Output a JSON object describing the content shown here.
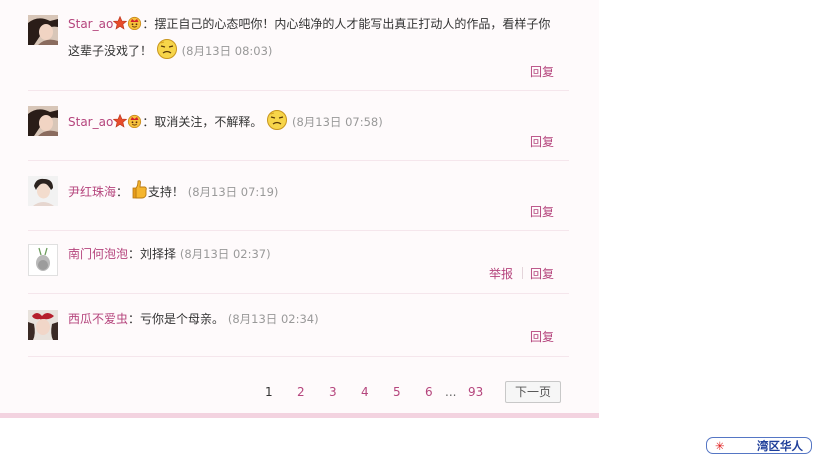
{
  "comments": [
    {
      "username": "Star_ao",
      "text_line1": "：摆正自己的心态吧你！内心纯净的人才能写出真正打动人的作品，看样子你",
      "text_line2": "这辈子没戏了！",
      "time": "(8月13日 08:03)",
      "reply_label": "回复",
      "badges": [
        "star-badge-icon",
        "crown-badge-icon"
      ],
      "emoticon": "sneer-face-icon"
    },
    {
      "username": "Star_ao",
      "text": "：取消关注，不解释。",
      "time": "(8月13日 07:58)",
      "reply_label": "回复",
      "badges": [
        "star-badge-icon",
        "crown-badge-icon"
      ],
      "emoticon": "sneer-face-icon"
    },
    {
      "username": "尹红珠海",
      "prefix": "：",
      "text": "支持！",
      "time": "(8月13日 07:19)",
      "reply_label": "回复",
      "emoticon": "thumbs-up-icon"
    },
    {
      "username": "南门何泡泡",
      "text": "：刘择择",
      "time": "(8月13日 02:37)",
      "report_label": "举报",
      "reply_label": "回复"
    },
    {
      "username": "西瓜不爱虫",
      "text": "：亏你是个母亲。",
      "time": "(8月13日 02:34)",
      "reply_label": "回复"
    }
  ],
  "pagination": {
    "pages": [
      "1",
      "2",
      "3",
      "4",
      "5",
      "6"
    ],
    "ellipsis": "...",
    "last_page": "93",
    "current_page": "1",
    "next_label": "下一页"
  },
  "watermark": {
    "text": "湾区华人",
    "star": "✳"
  },
  "colors": {
    "username": "#b5457d",
    "panel_bg": "#fefafb",
    "panel_border": "#f3d3e0",
    "time": "#999999"
  }
}
